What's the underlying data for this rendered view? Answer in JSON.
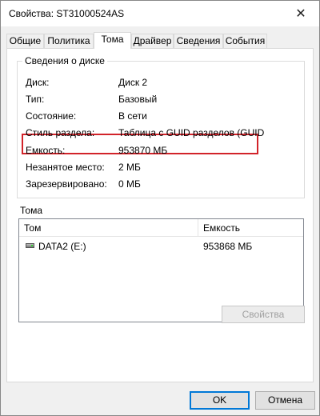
{
  "window": {
    "title": "Свойства: ST31000524AS",
    "close_icon": "close-icon"
  },
  "tabs": [
    {
      "label": "Общие",
      "active": false
    },
    {
      "label": "Политика",
      "active": false
    },
    {
      "label": "Тома",
      "active": true
    },
    {
      "label": "Драйвер",
      "active": false
    },
    {
      "label": "Сведения",
      "active": false
    },
    {
      "label": "События",
      "active": false
    }
  ],
  "disk_info": {
    "legend": "Сведения о диске",
    "rows": [
      {
        "label": "Диск:",
        "value": "Диск 2"
      },
      {
        "label": "Тип:",
        "value": "Базовый"
      },
      {
        "label": "Состояние:",
        "value": "В сети"
      },
      {
        "label": "Стиль раздела:",
        "value": "Таблица с GUID разделов (GUID"
      },
      {
        "label": "Емкость:",
        "value": "953870 МБ"
      },
      {
        "label": "Незанятое место:",
        "value": "2 МБ"
      },
      {
        "label": "Зарезервировано:",
        "value": "0 МБ"
      }
    ],
    "highlight_color": "#d2232a"
  },
  "volumes": {
    "label": "Тома",
    "columns": [
      "Том",
      "Емкость"
    ],
    "rows": [
      {
        "icon": "drive-icon",
        "name": "DATA2 (E:)",
        "capacity": "953868 МБ"
      }
    ]
  },
  "buttons": {
    "properties": "Свойства",
    "ok": "OK",
    "cancel": "Отмена"
  },
  "colors": {
    "accent": "#0078d7",
    "highlight": "#d2232a"
  }
}
